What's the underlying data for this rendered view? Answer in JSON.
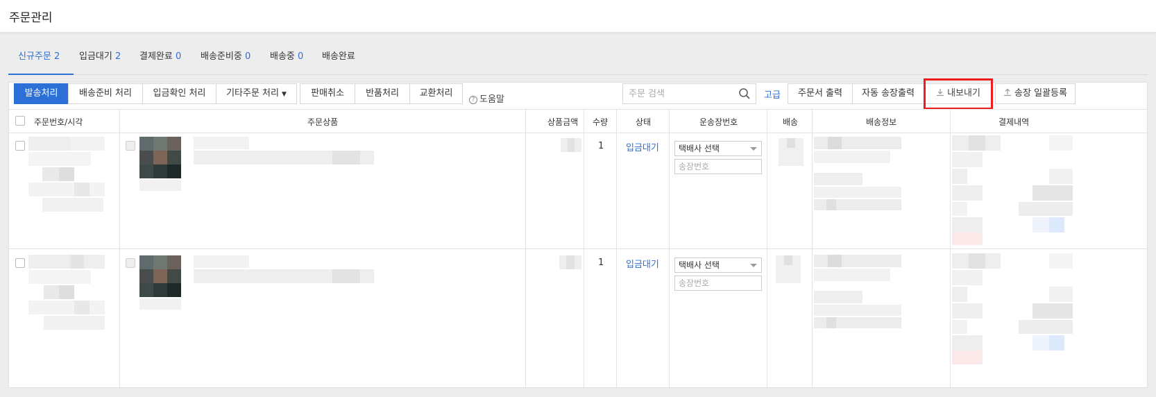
{
  "header": {
    "title": "주문관리"
  },
  "tabs": [
    {
      "label": "신규주문",
      "count": "2"
    },
    {
      "label": "입금대기",
      "count": "2"
    },
    {
      "label": "결제완료",
      "count": "0"
    },
    {
      "label": "배송준비중",
      "count": "0"
    },
    {
      "label": "배송중",
      "count": "0"
    },
    {
      "label": "배송완료",
      "count": ""
    }
  ],
  "toolbar": {
    "ship_process": "발송처리",
    "prepare_ship": "배송준비 처리",
    "confirm_deposit": "입금확인 처리",
    "other_orders": "기타주문 처리",
    "cancel_sale": "판매취소",
    "return_process": "반품처리",
    "exchange_process": "교환처리",
    "help": "도움말",
    "search_placeholder": "주문 검색",
    "advanced": "고급",
    "print_order": "주문서 출력",
    "auto_invoice_print": "자동 송장출력",
    "export": "내보내기",
    "bulk_invoice": "송장 일괄등록"
  },
  "table": {
    "headers": [
      "주문번호/시각",
      "주문상품",
      "상품금액",
      "수량",
      "상태",
      "운송장번호",
      "배송",
      "배송정보",
      "결제내역"
    ],
    "rows": [
      {
        "qty": "1",
        "status": "입금대기",
        "courier": "택배사 선택",
        "tracking_placeholder": "송장번호"
      },
      {
        "qty": "1",
        "status": "입금대기",
        "courier": "택배사 선택",
        "tracking_placeholder": "송장번호"
      }
    ]
  },
  "colors": {
    "accent": "#2c6fd6",
    "highlight": "#ee1c1c"
  },
  "icons": {
    "search": "search-icon",
    "export": "download-icon",
    "bulk": "upload-icon",
    "help": "question-circle-icon"
  }
}
